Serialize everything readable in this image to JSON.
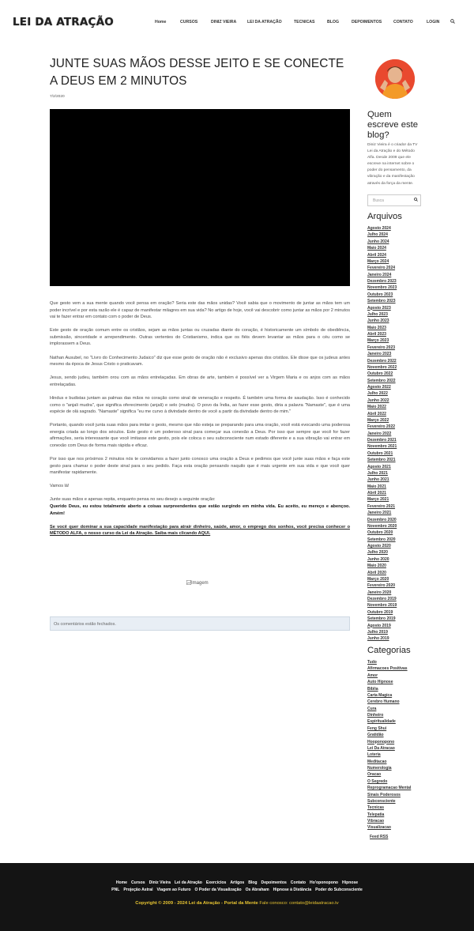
{
  "header": {
    "logo": "LEI DA ATRAÇÃO",
    "nav": [
      "Home",
      "CURSOS",
      "DINIZ VIEIRA",
      "LEI DA ATRAÇÃO",
      "TECNICAS",
      "BLOG",
      "DEPOIMENTOS",
      "CONTATO",
      "LOGIN"
    ]
  },
  "post": {
    "title": "JUNTE SUAS MÃOS DESSE JEITO E SE CONECTE A DEUS EM 2 MINUTOS",
    "date": "7/2/2020",
    "p1": "Que gesto vem a sua mente quando você pensa em oração? Seria este das mãos unidas? Você sabia que o movimento de juntar as mãos tem um poder incrível e por esta razão ele é capaz de manifestar milagres em sua vida? No artigo de hoje, você vai descobrir como juntar as mãos por 2 minutos vai te fazer entrar em contato com o poder de Deus.",
    "p2": "Este gesto de oração comum entre os cristãos, sejam as mãos juntas ou cruzadas diante do coração, é historicamente um símbolo de obediência, submissão, sinceridade e arrependimento. Outras vertentes do Cristianismo, indica que os fiéis devem levantar as mãos para o céu como se implorassem a Deus.",
    "p3": "Nathan Ausubel, no \"Livro do Conhecimento Judaico\" diz que esse gesto de oração não é exclusivo apenas dos cristãos. Ele disse que os judeus antes mesmo da época de Jesus Cristo o praticavam.",
    "p4": "Jesus, sendo judeu, também orou com as mãos entrelaçadas. Em obras de arte, também é possível ver a Virgem Maria e os anjos com as mãos entrelaçadas.",
    "p5": "Hindus e budistas juntam as palmas das mãos no coração como sinal de veneração e respeito. É também uma forma de saudação. Isso é conhecido como o \"anjali mudra\", que significa oferecimento (anjali) e selo (mudra). O povo da Índia, ao fazer esse gesto, diria a palavra \"Namaste\", que é uma espécie de olá sagrado. \"Namaste\" significa \"eu me curvo à divindade dentro de você a partir da divindade dentro de mim.\"",
    "p6": "Portanto, quando você junta suas mãos para imitar o gesto, mesmo que não esteja se preparando para uma oração, você está evocando uma poderosa energia criada ao longo dos séculos. Este gesto é um poderoso sinal para começar sua conexão a Deus. Por isso que sempre que você for fazer afirmações, seria interessante que você imitasse este gesto, pois ele coloca o seu subconsciente num estado diferente e a sua vibração vai entrar em conexão com Deus de forma mais rápida e eficaz.",
    "p7": "Por isso que nos próximos 2 minutos nós te convidamos a fazer junto conosco uma oração a Deus e pedimos que você junte suas mãos e faça este gesto para chamar o poder deste sinal para o seu pedido. Faça esta oração pensando naquilo que é mais urgente em sua vida e que você quer manifestar rapidamente.",
    "p8": "Vamos lá!",
    "p9a": "Junte suas mãos e apenas repita, enquanto pensa no seu desejo a seguinte oração:",
    "p9b": "Querido Deus, eu estou totalmente aberto a coisas surpreendentes que estão surgindo em minha vida. Eu aceito, eu mereço e abençoo. Amém!",
    "p10": "Se você quer dominar a sua capacidade manifestação para atrair dinheiro, saúde, amor, o emprego dos sonhos, você precisa conhecer o MÉTODO ALFA, o nosso curso da Lei da Atração. Saiba mais clicando AQUI.",
    "image_alt": "Imagem",
    "comments_closed": "Os comentários estão fechados."
  },
  "sidebar": {
    "about_title": "Quem escreve este blog?",
    "about_text": "Diniz Vieira é o criador da TV Lei da Atração e do Método Alfa. Desde 2009 que ele escreve na internet sobre o poder do pensamento, da vibração e da manifestação através da força da mente.",
    "search_placeholder": "Busca",
    "archives_title": "Arquivos",
    "archives": [
      "Agosto 2024",
      "Julho 2024",
      "Junho 2024",
      "Maio 2024",
      "Abril 2024",
      "Março 2024",
      "Fevereiro 2024",
      "Janeiro 2024",
      "Dezembro 2023",
      "Novembro 2023",
      "Outubro 2023",
      "Setembro 2023",
      "Agosto 2023",
      "Julho 2023",
      "Junho 2023",
      "Maio 2023",
      "Abril 2023",
      "Março 2023",
      "Fevereiro 2023",
      "Janeiro 2023",
      "Dezembro 2022",
      "Novembro 2022",
      "Outubro 2022",
      "Setembro 2022",
      "Agosto 2022",
      "Julho 2022",
      "Junho 2022",
      "Maio 2022",
      "Abril 2022",
      "Março 2022",
      "Fevereiro 2022",
      "Janeiro 2022",
      "Dezembro 2021",
      "Novembro 2021",
      "Outubro 2021",
      "Setembro 2021",
      "Agosto 2021",
      "Julho 2021",
      "Junho 2021",
      "Maio 2021",
      "Abril 2021",
      "Março 2021",
      "Fevereiro 2021",
      "Janeiro 2021",
      "Dezembro 2020",
      "Novembro 2020",
      "Outubro 2020",
      "Setembro 2020",
      "Agosto 2020",
      "Julho 2020",
      "Junho 2020",
      "Maio 2020",
      "Abril 2020",
      "Março 2020",
      "Fevereiro 2020",
      "Janeiro 2020",
      "Dezembro 2019",
      "Novembro 2019",
      "Outubro 2019",
      "Setembro 2019",
      "Agosto 2019",
      "Julho 2019",
      "Junho 2019"
    ],
    "categories_title": "Categorias",
    "categories": [
      "Tudo",
      "Afirmacoes Positivas",
      "Amor",
      "Auto Hipnose",
      "Bíblia",
      "Carta Magica",
      "Cerebro Humano",
      "Cura",
      "Dinheiro",
      "Espiritualidade",
      "Feng Shui",
      "Gratidão",
      "Hooponopono",
      "Lei Da Atracao",
      "Loteria",
      "Meditacao",
      "Numerologia",
      "Oracao",
      "O Segredo",
      "Reprogramacao Mental",
      "Sinais Poderosos",
      "Subconsciente",
      "Tecnicas",
      "Telepatia",
      "Vibracao",
      "Visualizacao"
    ],
    "rss": "Feed RSS"
  },
  "footer": {
    "row1": [
      "Home",
      "Cursos",
      "Diniz Vieira",
      "Lei da Atração",
      "Exercícios",
      "Artigos",
      "Blog",
      "Depoimentos",
      "Contato",
      "Ho'oponopono",
      "Hipnose"
    ],
    "row2": [
      "PNL",
      "Projeção Astral",
      "Viagem ao Futuro",
      "O Poder da Visualização",
      "Os Abraham",
      "Hipnose à Distância",
      "Poder do Subconsciente"
    ],
    "copyright": "Copyright © 2009 - 2024 Lei da Atração - Portal da Mente",
    "contact": "Fale conosco: contato@leidaatracao.tv"
  },
  "colors": {
    "footer_bg": "#141414",
    "copyright": "#e8c532",
    "comment_box": "#e8eef5",
    "avatar": "#e9492f"
  }
}
